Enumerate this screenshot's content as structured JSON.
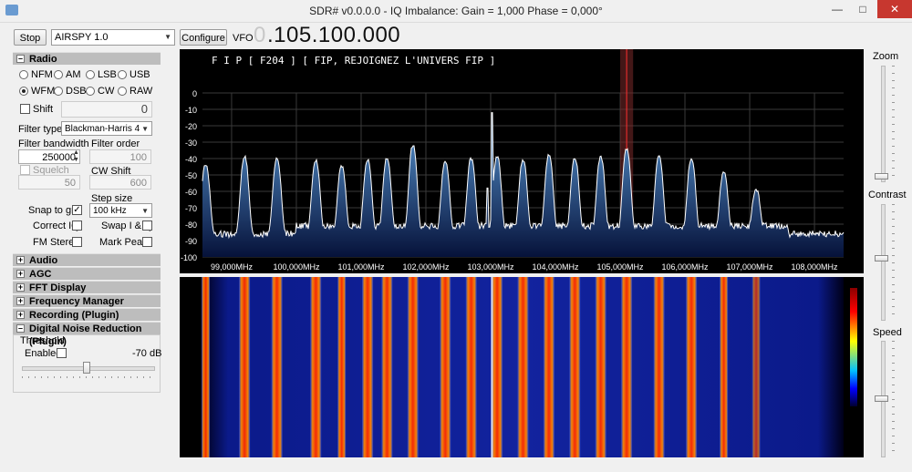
{
  "window": {
    "title": "SDR# v0.0.0.0 - IQ Imbalance: Gain = 1,000 Phase = 0,000°",
    "minimize": "—",
    "maximize": "□",
    "close": "✕"
  },
  "toolbar": {
    "stop_label": "Stop",
    "device": "AIRSPY 1.0",
    "configure_label": "Configure",
    "vfo_label": "VFO",
    "vfo_lead": "0",
    "vfo_value": ".105.100.000"
  },
  "radio": {
    "title": "Radio",
    "modes": [
      {
        "label": "NFM",
        "selected": false
      },
      {
        "label": "AM",
        "selected": false
      },
      {
        "label": "LSB",
        "selected": false
      },
      {
        "label": "USB",
        "selected": false
      },
      {
        "label": "WFM",
        "selected": true
      },
      {
        "label": "DSB",
        "selected": false
      },
      {
        "label": "CW",
        "selected": false
      },
      {
        "label": "RAW",
        "selected": false
      }
    ],
    "shift_label": "Shift",
    "shift_value": "0",
    "filter_type_label": "Filter type",
    "filter_type": "Blackman-Harris 4",
    "filter_bandwidth_label": "Filter bandwidth",
    "filter_bandwidth": "250000",
    "filter_order_label": "Filter order",
    "filter_order": "100",
    "squelch_label": "Squelch",
    "squelch_value": "50",
    "cw_shift_label": "CW Shift",
    "cw_shift": "600",
    "step_size_label": "Step size",
    "snap_label": "Snap to grid",
    "step_size": "100 kHz",
    "correct_iq_label": "Correct IQ",
    "swap_iq_label": "Swap I & Q",
    "fm_stereo_label": "FM Stereo",
    "mark_peaks_label": "Mark Peaks"
  },
  "sections": {
    "audio": "Audio",
    "agc": "AGC",
    "fft": "FFT Display",
    "freq_mgr": "Frequency Manager (Plugin)",
    "recording": "Recording (Plugin)",
    "dnr": "Digital Noise Reduction (Plugin)"
  },
  "dnr": {
    "threshold_label": "Threshold",
    "enabled_label": "Enabled",
    "db_value": "-70 dB"
  },
  "right_panel": {
    "zoom_label": "Zoom",
    "contrast_label": "Contrast",
    "speed_label": "Speed"
  },
  "spectrum": {
    "rds_text": "F I P   [ F204 ]   [ FIP, REJOIGNEZ L'UNIVERS FIP ]",
    "y_ticks": [
      "0",
      "-10",
      "-20",
      "-30",
      "-40",
      "-50",
      "-60",
      "-70",
      "-80",
      "-90",
      "-100"
    ],
    "x_ticks": [
      "99,000MHz",
      "100,000MHz",
      "101,000MHz",
      "102,000MHz",
      "103,000MHz",
      "104,000MHz",
      "105,000MHz",
      "106,000MHz",
      "107,000MHz",
      "108,000MHz"
    ],
    "peaks_mhz": [
      98.6,
      99.2,
      99.7,
      100.3,
      100.7,
      101.1,
      101.4,
      101.8,
      102.3,
      102.7,
      103.1,
      103.5,
      103.9,
      104.3,
      104.7,
      105.1,
      105.6,
      106.1,
      106.6,
      107.1
    ],
    "peaks_db": [
      -45,
      -40,
      -41,
      -42,
      -46,
      -42,
      -41,
      -33,
      -43,
      -41,
      -40,
      -42,
      -39,
      -41,
      -40,
      -35,
      -40,
      -41,
      -50,
      -60
    ],
    "colors": {
      "trace": "#ffffff",
      "fill_top": "#5a9ad6",
      "fill_bottom": "#06123a",
      "filter_band": "#7a2a2a",
      "center_line": "#ff3030"
    }
  }
}
